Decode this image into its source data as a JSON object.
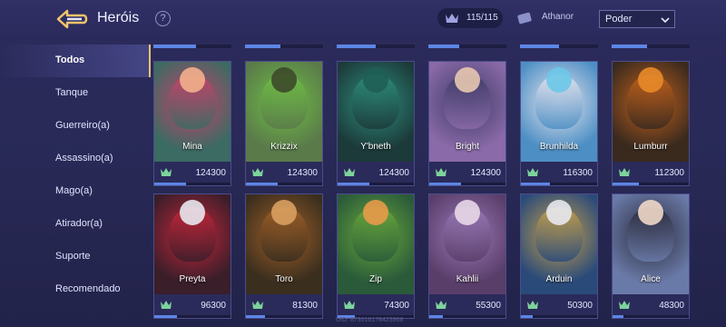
{
  "header": {
    "title": "Heróis",
    "help_glyph": "?",
    "hero_count": "115/115",
    "player_name": "Athanor",
    "sort_value": "Poder"
  },
  "sidebar": {
    "items": [
      {
        "label": "Todos",
        "active": true
      },
      {
        "label": "Tanque"
      },
      {
        "label": "Guerreiro(a)"
      },
      {
        "label": "Assassino(a)"
      },
      {
        "label": "Mago(a)"
      },
      {
        "label": "Atirador(a)"
      },
      {
        "label": "Suporte"
      },
      {
        "label": "Recomendado"
      }
    ]
  },
  "peek_progress": [
    0.55,
    0.45,
    0.5,
    0.4,
    0.5,
    0.45
  ],
  "heroes": [
    {
      "name": "Mina",
      "power": "124300",
      "progress": 0.42,
      "colors": [
        "#3b6b63",
        "#c9406a",
        "#f2b08c"
      ]
    },
    {
      "name": "Krizzix",
      "power": "124300",
      "progress": 0.42,
      "colors": [
        "#5a7a4a",
        "#6fbf45",
        "#3d4a2a"
      ]
    },
    {
      "name": "Y'bneth",
      "power": "124300",
      "progress": 0.42,
      "colors": [
        "#1c3a3a",
        "#2e8f7c",
        "#1f5e55"
      ]
    },
    {
      "name": "Bright",
      "power": "124300",
      "progress": 0.42,
      "colors": [
        "#8a6aa8",
        "#3d3a66",
        "#e8c8b0"
      ]
    },
    {
      "name": "Brunhilda",
      "power": "116300",
      "progress": 0.38,
      "colors": [
        "#4d8fc4",
        "#e9e6ef",
        "#6cc8e8"
      ]
    },
    {
      "name": "Lumburr",
      "power": "112300",
      "progress": 0.35,
      "colors": [
        "#3a2a1e",
        "#c4621c",
        "#e88a2a"
      ]
    },
    {
      "name": "Preyta",
      "power": "96300",
      "progress": 0.3,
      "colors": [
        "#3a1e2a",
        "#c6263a",
        "#e8e8f0"
      ]
    },
    {
      "name": "Toro",
      "power": "81300",
      "progress": 0.25,
      "colors": [
        "#3a2e1e",
        "#a06028",
        "#d8a060"
      ]
    },
    {
      "name": "Zip",
      "power": "74300",
      "progress": 0.23,
      "colors": [
        "#2a5a3a",
        "#6aa83a",
        "#e89a4a"
      ]
    },
    {
      "name": "Kahlii",
      "power": "55300",
      "progress": 0.18,
      "colors": [
        "#5a3e6a",
        "#9a7ab8",
        "#e8d8e8"
      ]
    },
    {
      "name": "Arduin",
      "power": "50300",
      "progress": 0.15,
      "colors": [
        "#2a4a7a",
        "#c8a24a",
        "#e8e8f0"
      ]
    },
    {
      "name": "Alice",
      "power": "48300",
      "progress": 0.14,
      "colors": [
        "#6a7aa8",
        "#2a2a3a",
        "#f0d8c8"
      ]
    }
  ],
  "uid_text": "UID: 873016178423968",
  "colors": {
    "accent": "#f0c46a",
    "progress": "#5c86e6",
    "rank_icon": "#7ed39c"
  }
}
